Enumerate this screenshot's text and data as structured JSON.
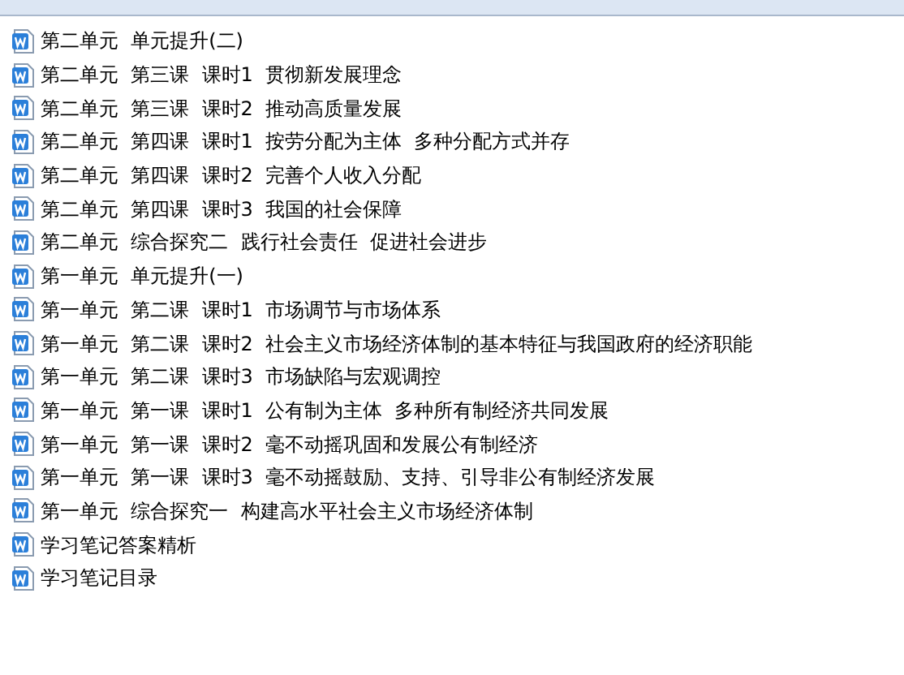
{
  "files": [
    {
      "name": "第二单元  单元提升(二)"
    },
    {
      "name": "第二单元  第三课  课时1  贯彻新发展理念"
    },
    {
      "name": "第二单元  第三课  课时2  推动高质量发展"
    },
    {
      "name": "第二单元  第四课  课时1  按劳分配为主体  多种分配方式并存"
    },
    {
      "name": "第二单元  第四课  课时2  完善个人收入分配"
    },
    {
      "name": "第二单元  第四课  课时3  我国的社会保障"
    },
    {
      "name": "第二单元  综合探究二  践行社会责任  促进社会进步"
    },
    {
      "name": "第一单元  单元提升(一)"
    },
    {
      "name": "第一单元  第二课  课时1  市场调节与市场体系"
    },
    {
      "name": "第一单元  第二课  课时2  社会主义市场经济体制的基本特征与我国政府的经济职能"
    },
    {
      "name": "第一单元  第二课  课时3  市场缺陷与宏观调控"
    },
    {
      "name": "第一单元  第一课  课时1  公有制为主体  多种所有制经济共同发展"
    },
    {
      "name": "第一单元  第一课  课时2  毫不动摇巩固和发展公有制经济"
    },
    {
      "name": "第一单元  第一课  课时3  毫不动摇鼓励、支持、引导非公有制经济发展"
    },
    {
      "name": "第一单元  综合探究一  构建高水平社会主义市场经济体制"
    },
    {
      "name": "学习笔记答案精析"
    },
    {
      "name": "学习笔记目录"
    }
  ]
}
